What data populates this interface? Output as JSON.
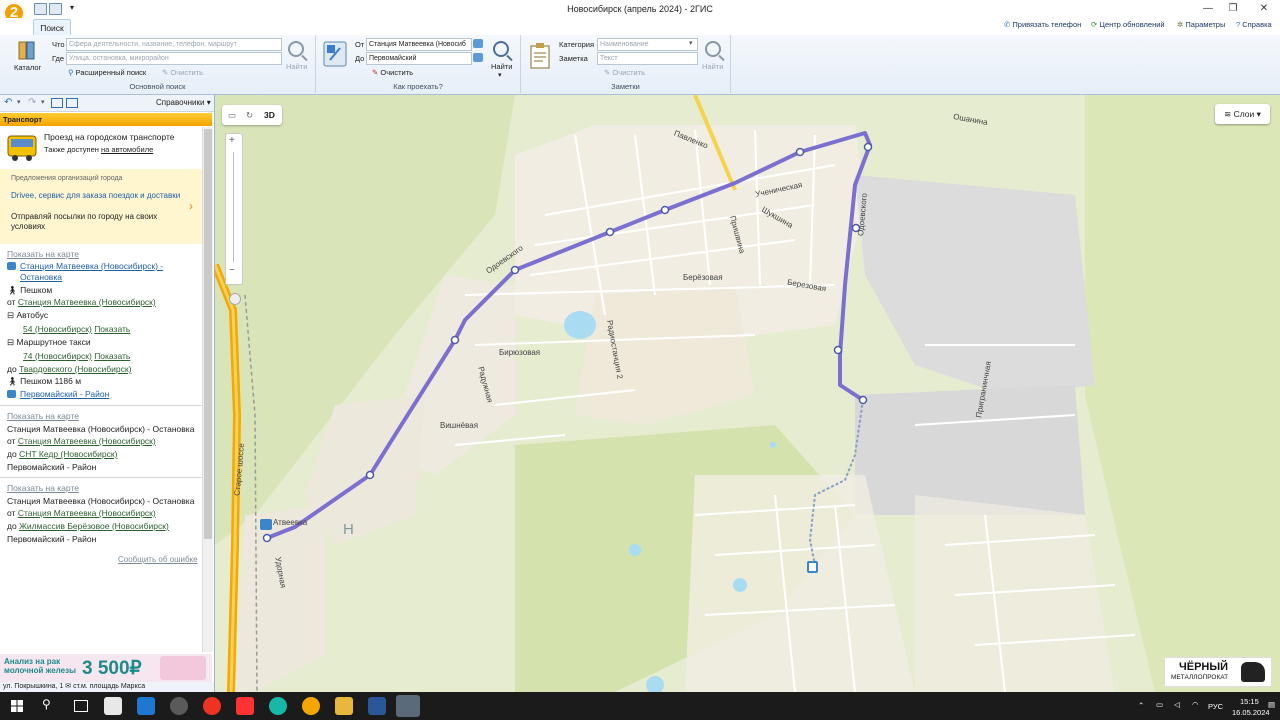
{
  "window": {
    "title": "Новосибирск (апрель 2024) - 2ГИС",
    "app_logo": "2"
  },
  "ribbon": {
    "tab": "Поиск",
    "top_links": [
      "Привязать телефон",
      "Центр обновлений",
      "Параметры",
      "Справка"
    ],
    "catalog_label": "Каталог",
    "main_search": {
      "what_label": "Что",
      "what_placeholder": "Сфера деятельности, название, телефон, маршрут",
      "where_label": "Где",
      "where_placeholder": "Улица, остановка, микрорайон",
      "advanced_label": "Расширенный поиск",
      "clear_label": "Очистить",
      "find_label": "Найти",
      "group_label": "Основной поиск"
    },
    "route": {
      "from_label": "От",
      "from_value": "Станция Матвеевка (Новосиб",
      "to_label": "До",
      "to_value": "Первомайский",
      "clear_label": "Очистить",
      "find_label": "Найти",
      "group_label": "Как проехать?"
    },
    "notes": {
      "category_label": "Категория",
      "category_placeholder": "Наименование",
      "note_label": "Заметка",
      "note_placeholder": "Текст",
      "clear_label": "Очистить",
      "find_label": "Найти",
      "group_label": "Заметки"
    }
  },
  "left_panel": {
    "toolbar_dropdown": "Справочники",
    "section_title": "Транспорт",
    "transit_title": "Проезд на городском транспорте",
    "transit_sub_prefix": "Также доступен",
    "transit_sub_link": "на автомобиле",
    "promo_caption": "Предложения организаций города",
    "promo_title": "Drivee, сервис для заказа поездок и доставки",
    "promo_text": "Отправляй посылки по городу на своих условиях",
    "route1": {
      "show_on_map": "Показать на карте",
      "start": "Станция Матвеевка (Новосибирск) - Остановка",
      "walk": "Пешком",
      "from_prefix": "от",
      "from_stop": "Станция Матвеевка (Новосибирск)",
      "bus": "Автобус",
      "bus_route": "54 (Новосибирск)",
      "show": "Показать",
      "minibus": "Маршрутное такси",
      "minibus_route": "74 (Новосибирск)",
      "to_prefix": "до",
      "to_stop": "Твардовского (Новосибирск)",
      "walk_end": "Пешком 1186 м",
      "end": "Первомайский - Район"
    },
    "route2": {
      "show_on_map": "Показать на карте",
      "start": "Станция Матвеевка (Новосибирск) - Остановка",
      "from_prefix": "от",
      "from_stop": "Станция Матвеевка (Новосибирск)",
      "to_prefix": "до",
      "to_stop": "СНТ Кедр (Новосибирск)",
      "end": "Первомайский - Район"
    },
    "route3": {
      "show_on_map": "Показать на карте",
      "start": "Станция Матвеевка (Новосибирск) - Остановка",
      "from_prefix": "от",
      "from_stop": "Станция Матвеевка (Новосибирск)",
      "to_prefix": "до",
      "to_stop": "Жилмассив Берёзовое (Новосибирск)",
      "end": "Первомайский - Район"
    },
    "report_error": "Сообщить об ошибке",
    "banner_text": "Анализ на рак молочной железы",
    "banner_price": "3 500₽",
    "status_text": "ул. Покрышкина, 1 ✉ ст.м. площадь Маркса"
  },
  "map": {
    "mode_3d": "3D",
    "layers_label": "Слои",
    "streets": [
      "Павленко",
      "Ученическая",
      "Шукшина",
      "Пришвина",
      "Берёзовая",
      "Березовая",
      "Радиостанция 2",
      "Одоевского",
      "Бирюзовая",
      "Радужная",
      "Вишнёвая",
      "Старое шоссе",
      "Удорная",
      "Ошанина",
      "Одоевского",
      "Пригранинчная",
      "Атвеевка"
    ],
    "district_letter": "Н",
    "ad_brand": "ЧЁРНЫЙ",
    "ad_sub": "МЕТАЛЛОПРОКАТ"
  },
  "taskbar": {
    "lang": "РУС",
    "time": "15:15",
    "date": "16.05.2024"
  },
  "colors": {
    "route": "#7b6fd0",
    "highway": "#f2a900",
    "forest": "#cfe3a8",
    "residential": "#f3efe4",
    "industrial": "#dcdcdc"
  }
}
